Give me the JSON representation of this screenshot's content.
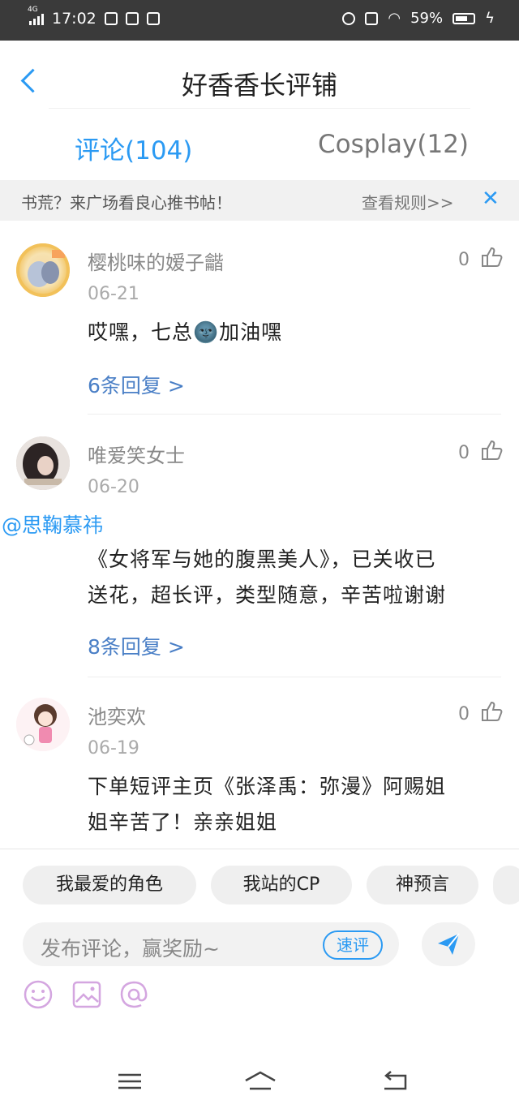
{
  "status_bar": {
    "network": "4G",
    "time": "17:02",
    "battery": "59%"
  },
  "header": {
    "title": "好香香长评铺"
  },
  "tabs": [
    {
      "label": "评论(104)",
      "active": true
    },
    {
      "label": "Cosplay(12)",
      "active": false
    }
  ],
  "banner": {
    "text": "书荒？来广场看良心推书帖！",
    "link": "查看规则>>",
    "close": "✕"
  },
  "comments": [
    {
      "username": "樱桃味的嫒子龤",
      "date": "06-21",
      "likes": "0",
      "body": "哎嘿，七总🌚加油嘿",
      "replies": "6条回复 >"
    },
    {
      "username": "唯爱笑女士",
      "date": "06-20",
      "likes": "0",
      "mention": "@思鞠慕祎",
      "body_line1": "《女将军与她的腹黑美人》，已关收已",
      "body_line2": "送花，超长评，类型随意，辛苦啦谢谢",
      "replies": "8条回复 >"
    },
    {
      "username": "池奕欢",
      "date": "06-19",
      "likes": "0",
      "body_line1": "下单短评主页《张泽禹：弥漫》阿赐姐",
      "body_line2": "姐辛苦了！亲亲姐姐"
    }
  ],
  "quick_chips": [
    "我最爱的角色",
    "我站的CP",
    "神预言"
  ],
  "comment_input": {
    "placeholder": "发布评论，赢奖励~",
    "quick_review": "速评"
  },
  "colors": {
    "accent": "#2b9af3",
    "reply_link": "#4a7fc6",
    "banner_bg": "#f1f1f1",
    "tool_icon": "#d4a6e0"
  },
  "icons": [
    "back-icon",
    "thumb-up-icon",
    "send-icon",
    "emoji-icon",
    "image-icon",
    "at-icon",
    "menu-icon",
    "home-icon",
    "back-nav-icon"
  ]
}
